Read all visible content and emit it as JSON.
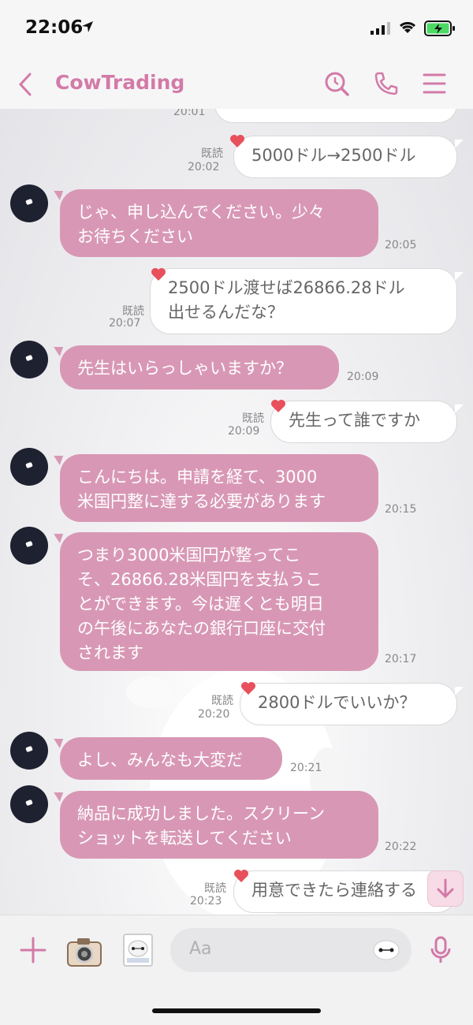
{
  "status": {
    "time": "22:06"
  },
  "header": {
    "title": "CowTrading"
  },
  "colors": {
    "accent": "#d37aa8",
    "incoming_bubble": "#d898b5",
    "outgoing_bubble": "#ffffff"
  },
  "messages": [
    {
      "dir": "out",
      "text": "",
      "time": "20:01"
    },
    {
      "dir": "out",
      "read": "既読",
      "time": "20:02",
      "text": "5000ドル→2500ドル"
    },
    {
      "dir": "in",
      "time": "20:05",
      "lines": [
        "じゃ、申し込んでください。少々",
        "お待ちください"
      ]
    },
    {
      "dir": "out",
      "read": "既読",
      "time": "20:07",
      "lines": [
        "2500ドル渡せば26866.28ドル",
        "出せるんだな？"
      ]
    },
    {
      "dir": "in",
      "time": "20:09",
      "lines": [
        "先生はいらっしゃいますか？"
      ]
    },
    {
      "dir": "out",
      "read": "既読",
      "time": "20:09",
      "text": "先生って誰ですか"
    },
    {
      "dir": "in",
      "time": "20:15",
      "lines": [
        "こんにちは。申請を経て、3000",
        "米国円整に達する必要があります"
      ]
    },
    {
      "dir": "in",
      "time": "20:17",
      "lines": [
        "つまり3000米国円が整ってこ",
        "そ、26866.28米国円を支払うこ",
        "とができます。今は遅くとも明日",
        "の午後にあなたの銀行口座に交付",
        "されます"
      ]
    },
    {
      "dir": "out",
      "read": "既読",
      "time": "20:20",
      "text": "2800ドルでいいか？"
    },
    {
      "dir": "in",
      "time": "20:21",
      "lines": [
        "よし、みんなも大変だ"
      ]
    },
    {
      "dir": "in",
      "time": "20:22",
      "lines": [
        "納品に成功しました。スクリーン",
        "ショットを転送してください"
      ]
    },
    {
      "dir": "out",
      "read": "既読",
      "time": "20:23",
      "text": "用意できたら連絡する"
    }
  ],
  "composer": {
    "placeholder": "Aa"
  }
}
